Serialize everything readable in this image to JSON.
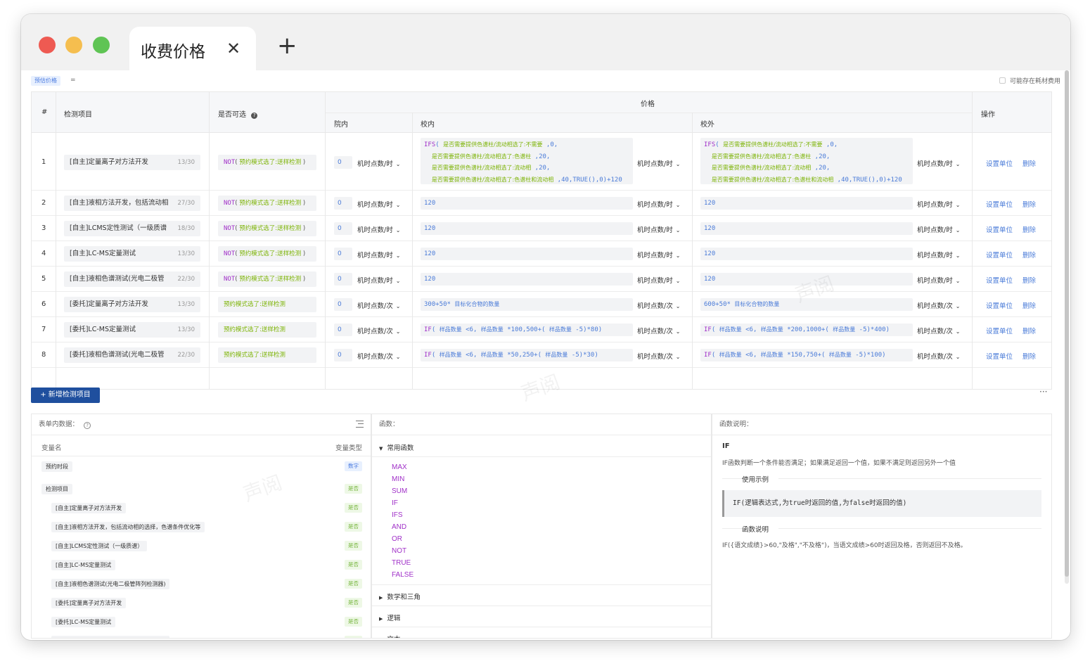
{
  "window": {
    "tab_title": "收费价格",
    "close_glyph": "✕",
    "new_tab_glyph": "+"
  },
  "topbar": {
    "mode_tag": "预估价格",
    "eq_glyph": "=",
    "consumable_label": "可能存在耗材费用"
  },
  "table": {
    "headers": {
      "num": "#",
      "item": "检测项目",
      "optional": "是否可选",
      "price_group": "价格",
      "in_lab": "院内",
      "on_campus": "校内",
      "off_campus": "校外",
      "ops": "操作"
    },
    "ops": {
      "set_unit": "设置单位",
      "delete": "删除"
    },
    "rows": [
      {
        "num": "1",
        "item": "[自主]定量离子对方法开发",
        "count": "13/30",
        "opt_kw": "NOT",
        "opt_paren_l": "(",
        "opt_var": "预约模式选了:送样检测",
        "opt_paren_r": ")",
        "in_val": "0",
        "in_unit": "机时点数/时",
        "campus_unit": "机时点数/时",
        "off_unit": "机时点数/时",
        "campus_lines": [
          {
            "kw": "IFS",
            "p": "(",
            "var": "是否需要提供色谱柱/流动相选了:不需要",
            "tail": " ,0,"
          },
          {
            "kw": "",
            "p": "",
            "var": "是否需要提供色谱柱/流动相选了:色谱柱",
            "tail": " ,20,"
          },
          {
            "kw": "",
            "p": "",
            "var": "是否需要提供色谱柱/流动相选了:流动相",
            "tail": " ,20,"
          },
          {
            "kw": "",
            "p": "",
            "var": "是否需要提供色谱柱/流动相选了:色谱柱和流动相",
            "tail": " ,40,TRUE(),0)+120"
          }
        ],
        "off_lines": [
          {
            "kw": "IFS",
            "p": "(",
            "var": "是否需要提供色谱柱/流动相选了:不需要",
            "tail": " ,0,"
          },
          {
            "kw": "",
            "p": "",
            "var": "是否需要提供色谱柱/流动相选了:色谱柱",
            "tail": " ,20,"
          },
          {
            "kw": "",
            "p": "",
            "var": "是否需要提供色谱柱/流动相选了:流动相",
            "tail": " ,20,"
          },
          {
            "kw": "",
            "p": "",
            "var": "是否需要提供色谱柱/流动相选了:色谱柱和流动相",
            "tail": " ,40,TRUE(),0)+120"
          }
        ]
      },
      {
        "num": "2",
        "item": "[自主]液相方法开发，包括流动相",
        "count": "27/30",
        "opt_kw": "NOT",
        "opt_paren_l": "(",
        "opt_var": "预约模式选了:送样检测",
        "opt_paren_r": ")",
        "in_val": "0",
        "in_unit": "机时点数/时",
        "campus": "120",
        "campus_unit": "机时点数/时",
        "off": "120",
        "off_unit": "机时点数/时"
      },
      {
        "num": "3",
        "item": "[自主]LCMS定性测试（一级质谱",
        "count": "18/30",
        "opt_kw": "NOT",
        "opt_paren_l": "(",
        "opt_var": "预约模式选了:送样检测",
        "opt_paren_r": ")",
        "in_val": "0",
        "in_unit": "机时点数/时",
        "campus": "120",
        "campus_unit": "机时点数/时",
        "off": "120",
        "off_unit": "机时点数/时"
      },
      {
        "num": "4",
        "item": "[自主]LC-MS定量测试",
        "count": "13/30",
        "opt_kw": "NOT",
        "opt_paren_l": "(",
        "opt_var": "预约模式选了:送样检测",
        "opt_paren_r": ")",
        "in_val": "0",
        "in_unit": "机时点数/时",
        "campus": "120",
        "campus_unit": "机时点数/时",
        "off": "120",
        "off_unit": "机时点数/时"
      },
      {
        "num": "5",
        "item": "[自主]液相色谱测试(光电二极管",
        "count": "22/30",
        "opt_kw": "NOT",
        "opt_paren_l": "(",
        "opt_var": "预约模式选了:送样检测",
        "opt_paren_r": ")",
        "in_val": "0",
        "in_unit": "机时点数/时",
        "campus": "120",
        "campus_unit": "机时点数/时",
        "off": "120",
        "off_unit": "机时点数/时"
      },
      {
        "num": "6",
        "item": "[委托]定量离子对方法开发",
        "count": "13/30",
        "opt_var": "预约模式选了:送样检测",
        "in_val": "0",
        "in_unit": "机时点数/次",
        "campus_pre": "300+50*",
        "campus_var": "目标化合物的数量",
        "campus_unit": "机时点数/次",
        "off_pre": "600+50*",
        "off_var": "目标化合物的数量",
        "off_unit": "机时点数/次"
      },
      {
        "num": "7",
        "item": "[委托]LC-MS定量测试",
        "count": "13/30",
        "opt_var": "预约模式选了:送样检测",
        "in_val": "0",
        "in_unit": "机时点数/次",
        "campus_if": {
          "kw": "IF",
          "a": "(",
          "v1": "样品数量",
          "b": " <6,",
          "v2": "样品数量",
          "c": " *100,500+(",
          "v3": "样品数量",
          "d": " -5)*80)"
        },
        "campus_unit": "机时点数/次",
        "off_if": {
          "kw": "IF",
          "a": "(",
          "v1": "样品数量",
          "b": " <6,",
          "v2": "样品数量",
          "c": " *200,1000+(",
          "v3": "样品数量",
          "d": " -5)*400)"
        },
        "off_unit": "机时点数/次"
      },
      {
        "num": "8",
        "item": "[委托]液相色谱测试(光电二极管",
        "count": "22/30",
        "opt_var": "预约模式选了:送样检测",
        "in_val": "0",
        "in_unit": "机时点数/次",
        "campus_if": {
          "kw": "IF",
          "a": "(",
          "v1": "样品数量",
          "b": " <6,",
          "v2": "样品数量",
          "c": " *50,250+(",
          "v3": "样品数量",
          "d": " -5)*30)"
        },
        "campus_unit": "机时点数/次",
        "off_if": {
          "kw": "IF",
          "a": "(",
          "v1": "样品数量",
          "b": " <6,",
          "v2": "样品数量",
          "c": " *150,750+(",
          "v3": "样品数量",
          "d": " -5)*100)"
        },
        "off_unit": "机时点数/次"
      }
    ]
  },
  "add_button": "+ 新增检测项目",
  "more_glyph": "···",
  "vars_panel": {
    "title": "表单内数据：",
    "col_name": "变量名",
    "col_type": "变量类型",
    "items": [
      {
        "name": "预约时段",
        "type": "数字",
        "kind": "num",
        "indent": false
      },
      {
        "name": "检测项目",
        "type": "是否",
        "kind": "bool",
        "indent": false
      },
      {
        "name": "[自主]定量离子对方法开发",
        "type": "是否",
        "kind": "bool",
        "indent": true
      },
      {
        "name": "[自主]液相方法开发，包括流动相的选择，色谱条件优化等",
        "type": "是否",
        "kind": "bool",
        "indent": true
      },
      {
        "name": "[自主]LCMS定性测试（一级质谱）",
        "type": "是否",
        "kind": "bool",
        "indent": true
      },
      {
        "name": "[自主]LC-MS定量测试",
        "type": "是否",
        "kind": "bool",
        "indent": true
      },
      {
        "name": "[自主]液相色谱测试(光电二极管阵列检测器)",
        "type": "是否",
        "kind": "bool",
        "indent": true
      },
      {
        "name": "[委托]定量离子对方法开发",
        "type": "是否",
        "kind": "bool",
        "indent": true
      },
      {
        "name": "[委托]LC-MS定量测试",
        "type": "是否",
        "kind": "bool",
        "indent": true
      },
      {
        "name": "[委托]液相色谱测试(光电二极管阵列检测器)",
        "type": "是否",
        "kind": "bool",
        "indent": true
      }
    ]
  },
  "funcs_panel": {
    "title": "函数：",
    "common_group": "常用函数",
    "common": [
      "MAX",
      "MIN",
      "SUM",
      "IF",
      "IFS",
      "AND",
      "OR",
      "NOT",
      "TRUE",
      "FALSE"
    ],
    "groups": [
      "数学和三角",
      "逻辑",
      "文本"
    ]
  },
  "desc_panel": {
    "title": "函数说明：",
    "func_name": "IF",
    "summary": "IF函数判断一个条件能否满足；如果满足返回一个值，如果不满足则返回另外一个值",
    "usage_label": "使用示例",
    "example": "IF(逻辑表达式,为true时返回的值,为false时返回的值)",
    "desc_label": "函数说明",
    "desc_text": "IF({语文成绩}>60,\"及格\",\"不及格\")，当语文成绩>60时返回及格，否则返回不及格。"
  },
  "watermark": "声阅"
}
